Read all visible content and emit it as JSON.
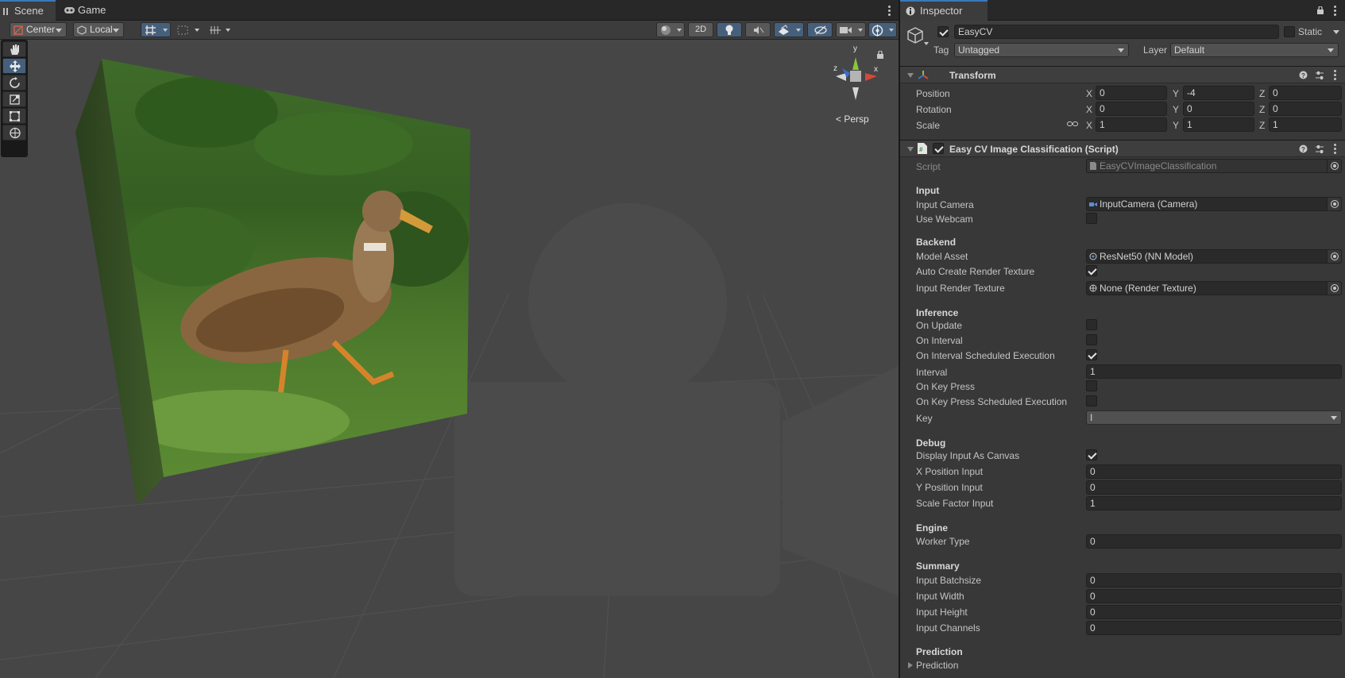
{
  "scene": {
    "tabs": [
      {
        "label": "Scene",
        "icon": "grid-icon",
        "active": true
      },
      {
        "label": "Game",
        "icon": "gamepad-icon",
        "active": false
      }
    ],
    "toolbar": {
      "pivot_label": "Center",
      "space_label": "Local",
      "mode_2d_label": "2D"
    },
    "persp_label": "Persp",
    "gizmo_axes": {
      "x": "x",
      "y": "y",
      "z": "z"
    }
  },
  "inspector": {
    "tab_label": "Inspector",
    "gameobject": {
      "name": "EasyCV",
      "active": true,
      "static_label": "Static",
      "tag_label": "Tag",
      "tag_value": "Untagged",
      "layer_label": "Layer",
      "layer_value": "Default"
    },
    "transform": {
      "title": "Transform",
      "position": {
        "label": "Position",
        "x": "0",
        "y": "-4",
        "z": "0"
      },
      "rotation": {
        "label": "Rotation",
        "x": "0",
        "y": "0",
        "z": "0"
      },
      "scale": {
        "label": "Scale",
        "x": "1",
        "y": "1",
        "z": "1"
      },
      "axis_x": "X",
      "axis_y": "Y",
      "axis_z": "Z"
    },
    "script_component": {
      "title": "Easy CV Image Classification (Script)",
      "enabled": true,
      "script_label": "Script",
      "script_value": "EasyCVImageClassification",
      "sections": {
        "input": "Input",
        "backend": "Backend",
        "inference": "Inference",
        "debug": "Debug",
        "engine": "Engine",
        "summary": "Summary",
        "prediction": "Prediction"
      },
      "input_camera": {
        "label": "Input Camera",
        "value": "InputCamera (Camera)"
      },
      "use_webcam": {
        "label": "Use Webcam",
        "checked": false
      },
      "model_asset": {
        "label": "Model Asset",
        "value": "ResNet50 (NN Model)"
      },
      "auto_create_rt": {
        "label": "Auto Create Render Texture",
        "checked": true
      },
      "input_rt": {
        "label": "Input Render Texture",
        "value": "None (Render Texture)"
      },
      "on_update": {
        "label": "On Update",
        "checked": false
      },
      "on_interval": {
        "label": "On Interval",
        "checked": false
      },
      "on_interval_sched": {
        "label": "On Interval Scheduled Execution",
        "checked": true
      },
      "interval": {
        "label": "Interval",
        "value": "1"
      },
      "on_key_press": {
        "label": "On Key Press",
        "checked": false
      },
      "on_key_press_sched": {
        "label": "On Key Press Scheduled Execution",
        "checked": false
      },
      "key": {
        "label": "Key",
        "value": "I"
      },
      "display_input_canvas": {
        "label": "Display Input As Canvas",
        "checked": true
      },
      "x_pos_input": {
        "label": "X Position Input",
        "value": "0"
      },
      "y_pos_input": {
        "label": "Y Position Input",
        "value": "0"
      },
      "scale_factor_input": {
        "label": "Scale Factor Input",
        "value": "1"
      },
      "worker_type": {
        "label": "Worker Type",
        "value": "0"
      },
      "input_batchsize": {
        "label": "Input Batchsize",
        "value": "0"
      },
      "input_width": {
        "label": "Input Width",
        "value": "0"
      },
      "input_height": {
        "label": "Input Height",
        "value": "0"
      },
      "input_channels": {
        "label": "Input Channels",
        "value": "0"
      },
      "prediction_foldout": "Prediction"
    }
  },
  "colors": {
    "accent": "#3a79bb",
    "scene_bg": "#464646",
    "panel_bg": "#383838"
  }
}
